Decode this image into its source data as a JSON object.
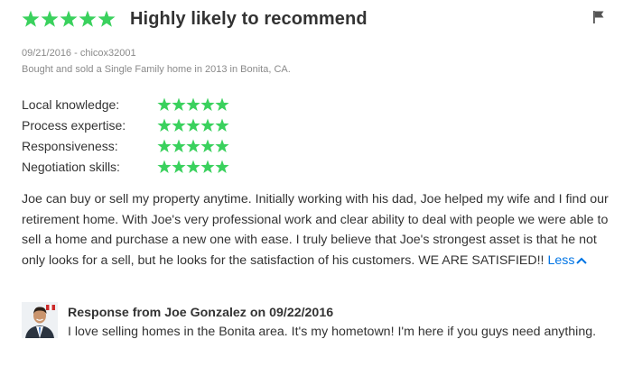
{
  "review": {
    "overall_rating": 5,
    "overall_max": 5,
    "headline": "Highly likely to recommend",
    "date_author": "09/21/2016 - chicox32001",
    "transaction": "Bought and sold a Single Family home in 2013 in Bonita, CA.",
    "ratings": [
      {
        "label": "Local knowledge:",
        "stars": 5
      },
      {
        "label": "Process expertise:",
        "stars": 5
      },
      {
        "label": "Responsiveness:",
        "stars": 5
      },
      {
        "label": "Negotiation skills:",
        "stars": 5
      }
    ],
    "body": "Joe can buy or sell my property anytime. Initially working with his dad, Joe helped my wife and I find our retirement home. With Joe's very professional work and clear ability to deal with people we were able to sell a home and purchase a new one with ease. I truly believe that Joe's strongest asset is that he not only looks for a sell, but he looks for the satisfaction of his customers. WE ARE SATISFIED!!",
    "less_label": "Less",
    "flag_icon": "flag-icon",
    "star_color": "#3ad15d",
    "link_color": "#0074e4"
  },
  "response": {
    "title": "Response from Joe Gonzalez on 09/22/2016",
    "text": "I love selling homes in the Bonita area. It's my hometown! I'm here if you guys need anything."
  }
}
